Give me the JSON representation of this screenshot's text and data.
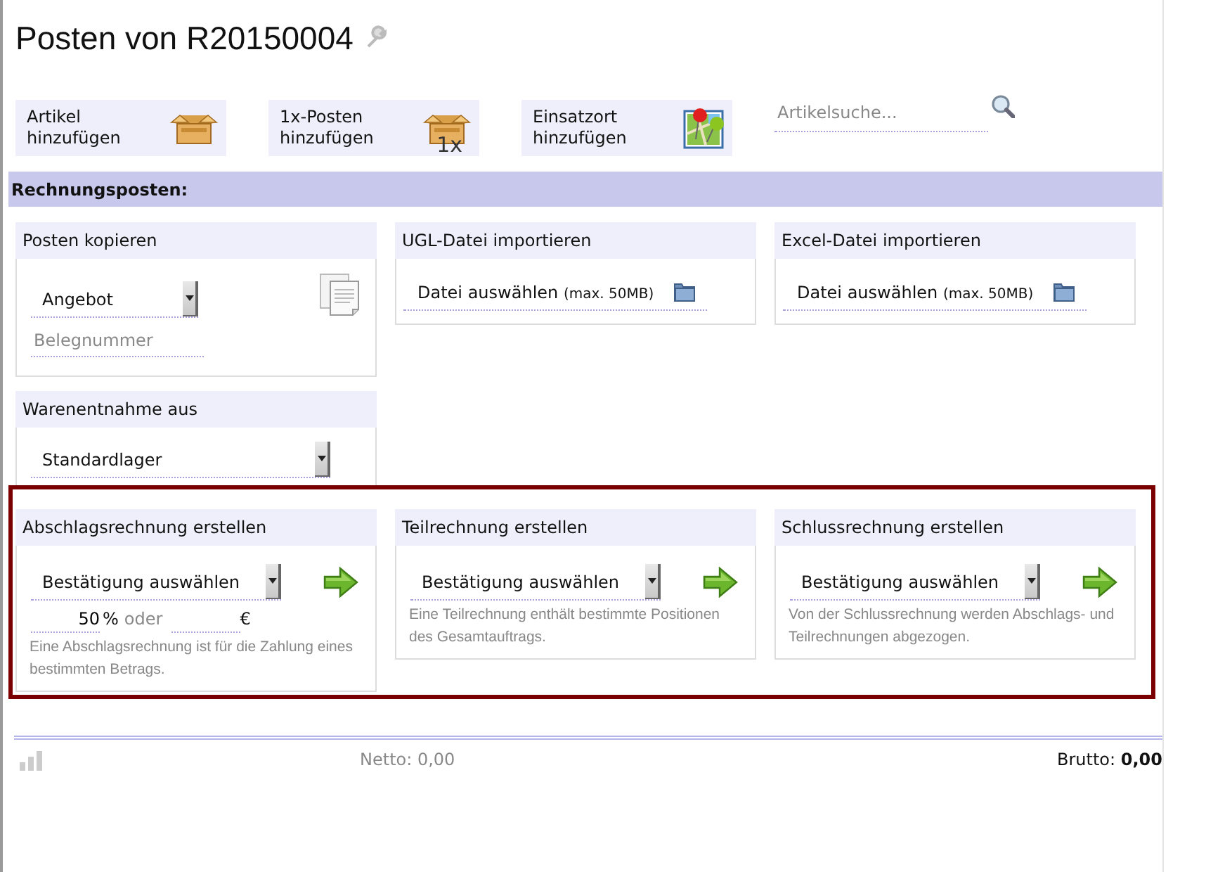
{
  "title": "Posten von R20150004",
  "toolbar": [
    {
      "label": "Artikel hinzufügen",
      "kind": "box"
    },
    {
      "label": "1x-Posten hinzufügen",
      "kind": "box",
      "badge": "1x"
    },
    {
      "label": "Einsatzort hinzufügen",
      "kind": "map"
    }
  ],
  "search": {
    "placeholder": "Artikelsuche..."
  },
  "section_title": "Rechnungsposten:",
  "panels": [
    {
      "title": "Posten kopieren",
      "kind": "copy",
      "select": "Angebot",
      "placeholder": "Belegnummer"
    },
    {
      "title": "UGL-Datei importieren",
      "kind": "file",
      "file_label": "Datei auswählen",
      "file_hint": "(max. 50MB)"
    },
    {
      "title": "Excel-Datei importieren",
      "kind": "file",
      "file_label": "Datei auswählen",
      "file_hint": "(max. 50MB)"
    },
    {
      "title": "Warenentnahme aus",
      "kind": "select",
      "select": "Standardlager"
    }
  ],
  "invoice_panels": [
    {
      "title": "Abschlagsrechnung erstellen",
      "select": "Bestätigung auswählen",
      "amount": {
        "percent": "50",
        "percent_sign": "%",
        "or": "oder",
        "currency": "€"
      },
      "note": "Eine Abschlagsrechnung ist für die Zahlung eines bestimmten Betrags."
    },
    {
      "title": "Teilrechnung erstellen",
      "select": "Bestätigung auswählen",
      "note": "Eine Teilrechnung enthält bestimmte Positionen des Gesamtauftrags."
    },
    {
      "title": "Schlussrechnung erstellen",
      "select": "Bestätigung auswählen",
      "note": "Von der Schlussrechnung werden Abschlags- und Teilrechnungen abgezogen."
    }
  ],
  "footer": {
    "netto": "Netto: 0,00",
    "brutto": "Brutto: **0,00**"
  }
}
